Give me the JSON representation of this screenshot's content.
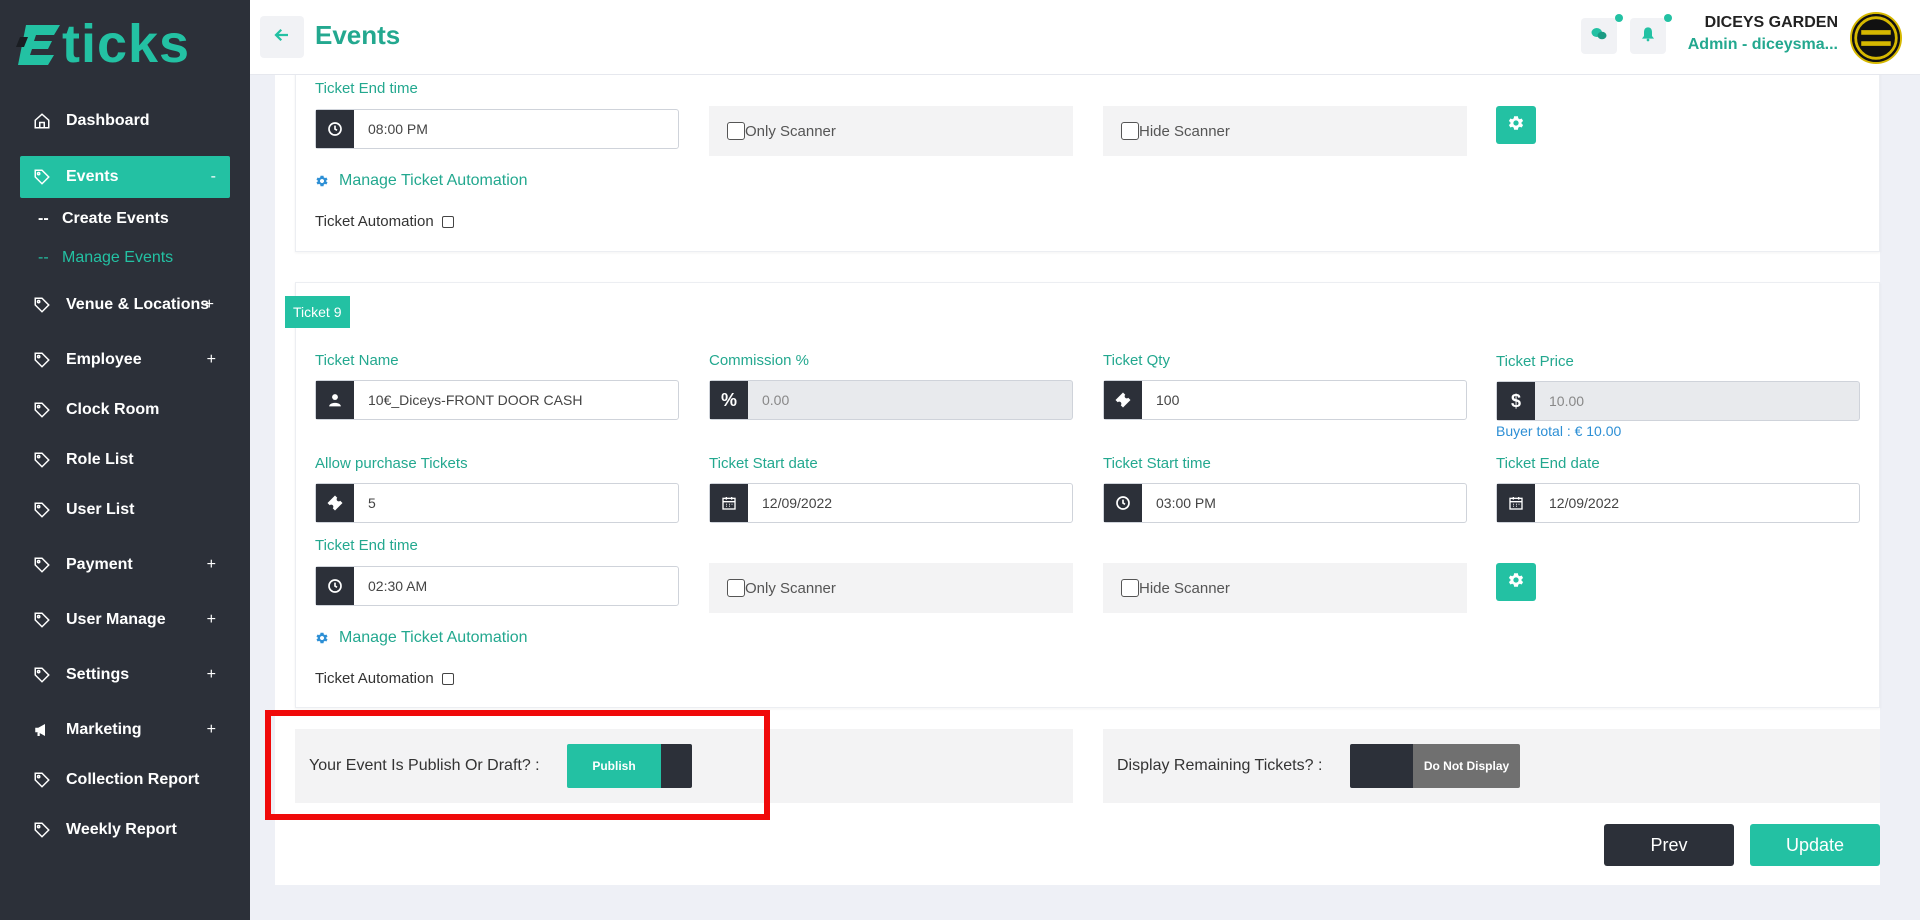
{
  "brand": {
    "logo_text": "ticks"
  },
  "sidebar": {
    "items": [
      {
        "label": "Dashboard",
        "icon": "home-icon",
        "plus": ""
      },
      {
        "label": "Events",
        "icon": "tag-icon",
        "plus": "-"
      },
      {
        "label": "Venue & Locations",
        "icon": "tag-icon",
        "plus": "+"
      },
      {
        "label": "Employee",
        "icon": "tag-icon",
        "plus": "+"
      },
      {
        "label": "Clock Room",
        "icon": "tag-icon",
        "plus": ""
      },
      {
        "label": "Role List",
        "icon": "tag-icon",
        "plus": ""
      },
      {
        "label": "User List",
        "icon": "tag-icon",
        "plus": ""
      },
      {
        "label": "Payment",
        "icon": "tag-icon",
        "plus": "+"
      },
      {
        "label": "User Manage",
        "icon": "tag-icon",
        "plus": "+"
      },
      {
        "label": "Settings",
        "icon": "tag-icon",
        "plus": "+"
      },
      {
        "label": "Marketing",
        "icon": "megaphone-icon",
        "plus": "+"
      },
      {
        "label": "Collection Report",
        "icon": "tag-icon",
        "plus": ""
      },
      {
        "label": "Weekly Report",
        "icon": "tag-icon",
        "plus": ""
      }
    ],
    "sub_items": [
      {
        "label": "Create Events",
        "prefix": "--"
      },
      {
        "label": "Manage Events",
        "prefix": "--"
      }
    ]
  },
  "header": {
    "title": "Events",
    "user_name": "DICEYS GARDEN",
    "user_role": "Admin - diceysma...",
    "avatar_text": "DICEYS GARDEN"
  },
  "ticket8": {
    "end_time_label": "Ticket End time",
    "end_time": "08:00 PM",
    "only_scanner": "Only Scanner",
    "hide_scanner": "Hide Scanner",
    "manage_automation": "Manage Ticket Automation",
    "automation_label": "Ticket Automation"
  },
  "ticket9": {
    "badge": "Ticket 9",
    "name_label": "Ticket Name",
    "name": "10€_Diceys-FRONT DOOR CASH",
    "commission_label": "Commission %",
    "commission": "0.00",
    "qty_label": "Ticket Qty",
    "qty": "100",
    "price_label": "Ticket Price",
    "price": "10.00",
    "buyer_total": "Buyer total : € 10.00",
    "allow_label": "Allow purchase Tickets",
    "allow": "5",
    "start_date_label": "Ticket Start date",
    "start_date": "12/09/2022",
    "start_time_label": "Ticket Start time",
    "start_time": "03:00 PM",
    "end_date_label": "Ticket End date",
    "end_date": "12/09/2022",
    "end_time_label": "Ticket End time",
    "end_time": "02:30 AM",
    "only_scanner": "Only Scanner",
    "hide_scanner": "Hide Scanner",
    "manage_automation": "Manage Ticket Automation",
    "automation_label": "Ticket Automation"
  },
  "publish": {
    "label": "Your Event Is Publish Or Draft? :",
    "toggle_label": "Publish"
  },
  "remaining": {
    "label": "Display Remaining Tickets? :",
    "toggle_label": "Do Not Display"
  },
  "actions": {
    "prev": "Prev",
    "update": "Update"
  },
  "colors": {
    "accent": "#23c1a3",
    "sidebar": "#2c3039",
    "highlight": "#f00a0a"
  }
}
